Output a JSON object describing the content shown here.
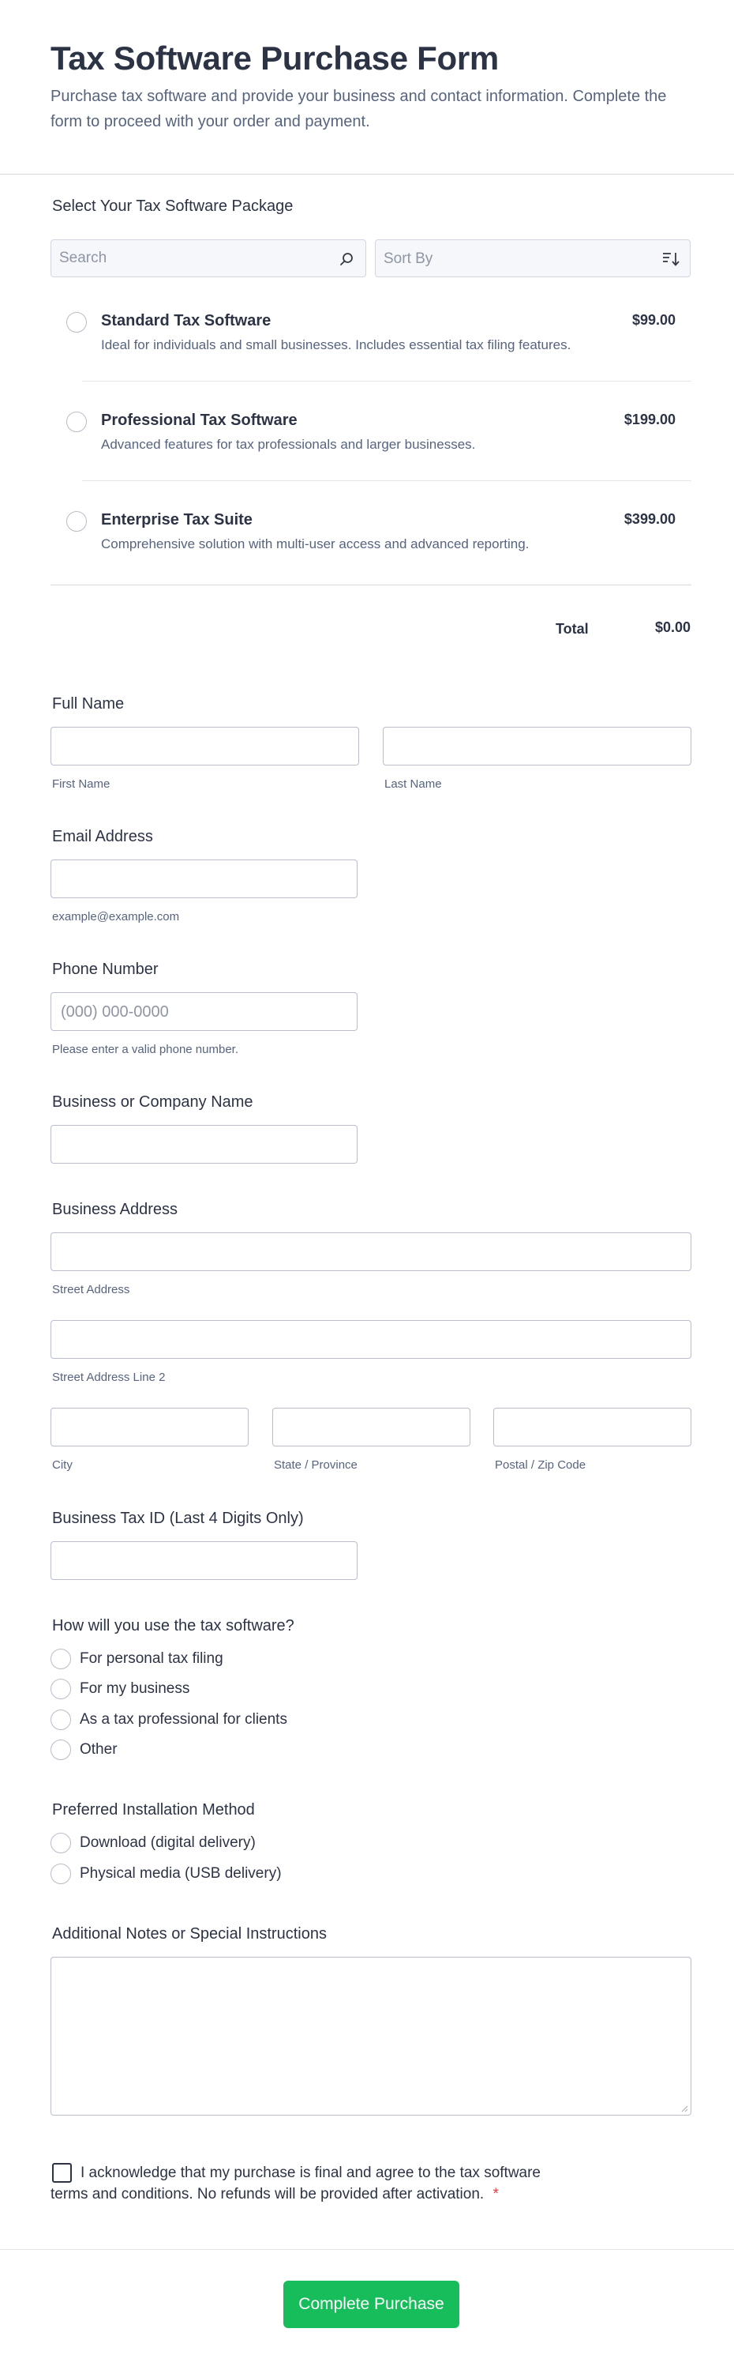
{
  "header": {
    "title": "Tax Software Purchase Form",
    "description": "Purchase tax software and provide your business and contact information. Complete the form to proceed with your order and payment."
  },
  "products": {
    "label": "Select Your Tax Software Package",
    "search_placeholder": "Search",
    "sort_placeholder": "Sort By",
    "items": [
      {
        "name": "Standard Tax Software",
        "description": "Ideal for individuals and small businesses. Includes essential tax filing features.",
        "price": "$99.00"
      },
      {
        "name": "Professional Tax Software",
        "description": "Advanced features for tax professionals and larger businesses.",
        "price": "$199.00"
      },
      {
        "name": "Enterprise Tax Suite",
        "description": "Comprehensive solution with multi-user access and advanced reporting.",
        "price": "$399.00"
      }
    ],
    "total_label": "Total",
    "total_value": "$0.00"
  },
  "full_name": {
    "label": "Full Name",
    "first": "First Name",
    "last": "Last Name"
  },
  "email": {
    "label": "Email Address",
    "sublabel": "example@example.com"
  },
  "phone": {
    "label": "Phone Number",
    "placeholder": "(000) 000-0000",
    "sublabel": "Please enter a valid phone number."
  },
  "company": {
    "label": "Business or Company Name"
  },
  "address": {
    "label": "Business Address",
    "street": "Street Address",
    "street2": "Street Address Line 2",
    "city": "City",
    "state": "State / Province",
    "zip": "Postal / Zip Code"
  },
  "tax_id": {
    "label": "Business Tax ID (Last 4 Digits Only)"
  },
  "usage": {
    "label": "How will you use the tax software?",
    "options": [
      "For personal tax filing",
      "For my business",
      "As a tax professional for clients",
      "Other"
    ]
  },
  "install": {
    "label": "Preferred Installation Method",
    "options": [
      "Download (digital delivery)",
      "Physical media (USB delivery)"
    ]
  },
  "notes": {
    "label": "Additional Notes or Special Instructions"
  },
  "terms": {
    "line1": "I acknowledge that my purchase is final and agree to the tax software",
    "line2": "terms and conditions. No refunds will be provided after activation.",
    "required_mark": "*"
  },
  "submit_label": "Complete Purchase",
  "colors": {
    "accent": "#18bd5b",
    "required": "#f23a3c",
    "text": "#2c3345",
    "muted": "#57647e"
  }
}
